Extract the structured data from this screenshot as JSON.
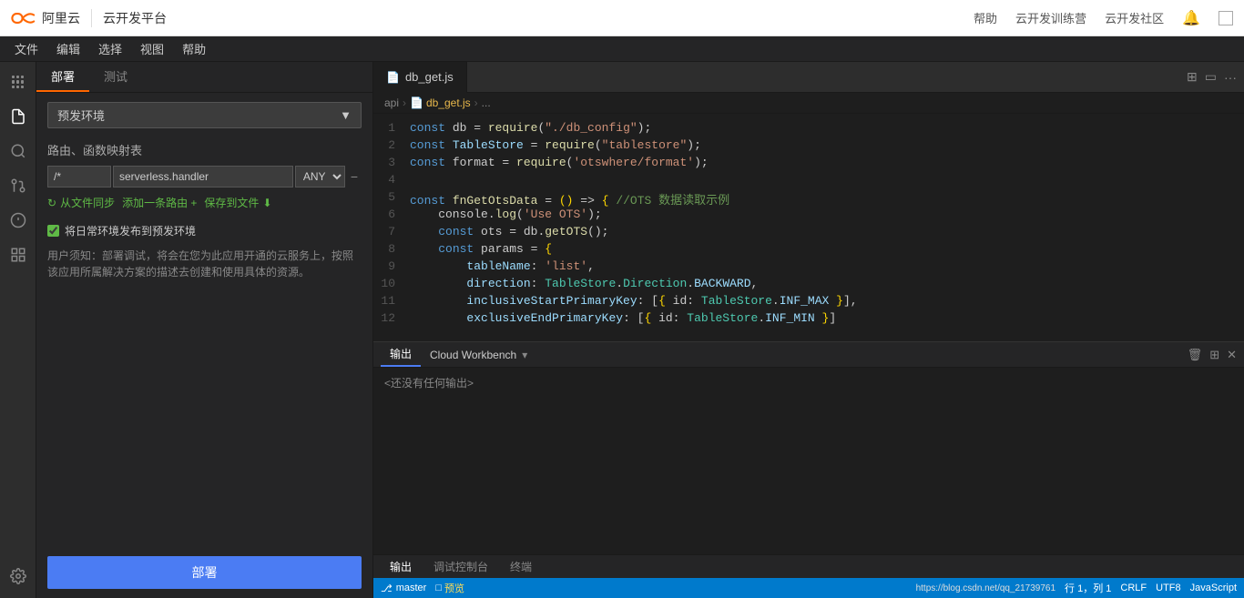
{
  "topbar": {
    "logo_text": "阿里云",
    "app_name": "云开发平台",
    "nav_links": [
      "帮助",
      "云开发训练营",
      "云开发社区"
    ]
  },
  "menubar": {
    "items": [
      "文件",
      "编辑",
      "选择",
      "视图",
      "帮助"
    ]
  },
  "sidebar": {
    "tabs": [
      "部署",
      "测试"
    ],
    "active_tab": "部署",
    "env_label": "预发环境",
    "section_title": "路由、函数映射表",
    "route_path": "/*",
    "route_handler": "serverless.handler",
    "route_method": "ANY",
    "sync_btn": "从文件同步",
    "add_btn": "添加一条路由 +",
    "save_btn": "保存到文件",
    "checkbox_label": "将日常环境发布到预发环境",
    "notice_title": "用户须知：部署调试，将会在您为此应用开通的云服务上，按照该应用所属解决方案的描述去创建和使用具体的资源。",
    "deploy_btn": "部署"
  },
  "editor": {
    "tab_name": "db_get.js",
    "breadcrumb": [
      "api",
      "db_get.js",
      "..."
    ],
    "lines": [
      {
        "num": 1,
        "code": "const db = require(\"./db_config\");"
      },
      {
        "num": 2,
        "code": "const TableStore = require(\"tablestore\");"
      },
      {
        "num": 3,
        "code": "const format = require('otswhere/format');"
      },
      {
        "num": 4,
        "code": ""
      },
      {
        "num": 5,
        "code": "const fnGetOtsData = () => { //OTS 数据读取示例"
      },
      {
        "num": 6,
        "code": "    console.log('Use OTS');"
      },
      {
        "num": 7,
        "code": "    const ots = db.getOTS();"
      },
      {
        "num": 8,
        "code": "    const params = {"
      },
      {
        "num": 9,
        "code": "        tableName: 'list',"
      },
      {
        "num": 10,
        "code": "        direction: TableStore.Direction.BACKWARD,"
      },
      {
        "num": 11,
        "code": "        inclusiveStartPrimaryKey: [{ id: TableStore.INF_MAX }],"
      },
      {
        "num": 12,
        "code": "        exclusiveEndPrimaryKey: [{ id: TableStore.INF_MIN }]"
      }
    ]
  },
  "output": {
    "title": "Cloud Workbench",
    "empty_text": "<还没有任何输出>",
    "tabs_bottom": [
      "输出",
      "调试控制台",
      "终端"
    ],
    "active_tab_bottom": "输出"
  },
  "statusbar": {
    "branch": "master",
    "preview_label": "预览",
    "position": "行 1，列 1",
    "encoding": "UTF8",
    "line_ending": "CRLF",
    "language": "JavaScript",
    "link": "https://blog.csdn.net/qq_21739761"
  }
}
